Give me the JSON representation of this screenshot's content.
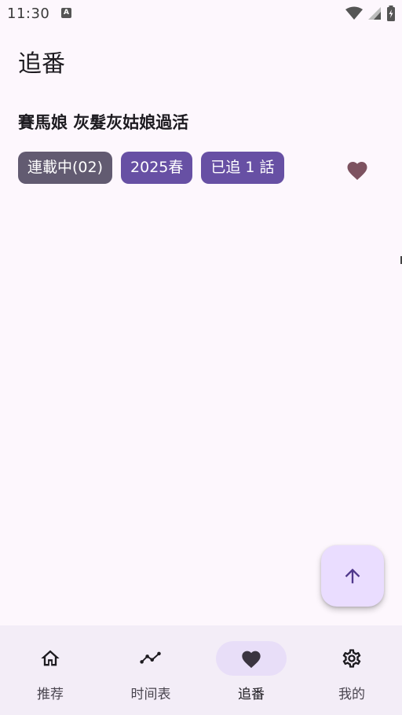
{
  "status_bar": {
    "time": "11:30",
    "app_icon_letter": "A",
    "icons": [
      "wifi-icon",
      "cell-signal-icon",
      "battery-icon"
    ]
  },
  "page": {
    "title": "追番"
  },
  "anime": {
    "title": "賽馬娘 灰髮灰姑娘過活",
    "status_chip": "連載中(02)",
    "season_chip": "2025春",
    "progress_chip": "已追 1 話",
    "favorited": true
  },
  "fab": {
    "icon": "arrow-up-icon"
  },
  "bottom_nav": {
    "items": [
      {
        "label": "推荐",
        "icon": "home-icon"
      },
      {
        "label": "时间表",
        "icon": "timeline-icon"
      },
      {
        "label": "追番",
        "icon": "heart-icon"
      },
      {
        "label": "我的",
        "icon": "gear-icon"
      }
    ],
    "active_index": 2
  },
  "colors": {
    "background": "#fdf7fd",
    "primary": "#6750a4",
    "secondary_chip": "#625b71",
    "heart": "#7d5260",
    "fab_container": "#eaddff",
    "nav_background": "#f3edf7",
    "nav_indicator": "#e8def8"
  }
}
